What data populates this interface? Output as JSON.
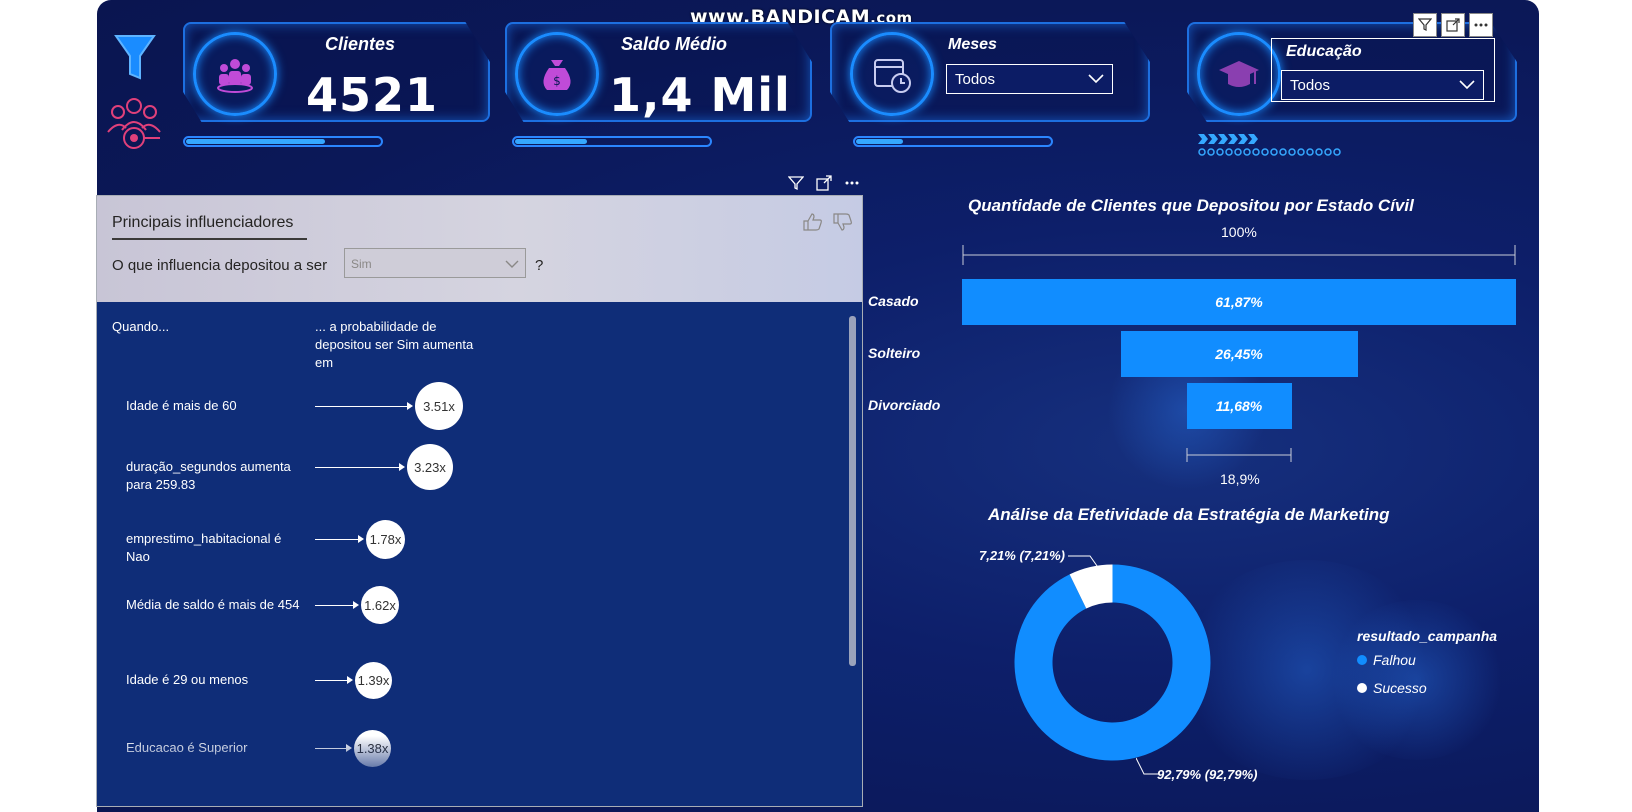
{
  "watermark": {
    "main": "www.BANDICAM",
    "suffix": ".com"
  },
  "kpis": {
    "clientes": {
      "title": "Clientes",
      "value": "4521",
      "progress": 0.72
    },
    "saldo": {
      "title": "Saldo Médio",
      "value": "1,4 Mil",
      "progress": 0.38
    },
    "meses": {
      "title": "Meses",
      "selected": "Todos",
      "progress": 0.25
    },
    "educacao": {
      "title": "Educação",
      "selected": "Todos"
    }
  },
  "influencers": {
    "title": "Principais influenciadores",
    "question": "O que influencia depositou a ser",
    "selected": "Sim",
    "question_mark": "?",
    "col_when": "Quando...",
    "col_prob": "... a probabilidade de depositou ser Sim aumenta em",
    "rows": [
      {
        "label": "Idade é mais de 60",
        "value": "3.51x",
        "factor": 3.51
      },
      {
        "label": "duração_segundos aumenta para 259.83",
        "value": "3.23x",
        "factor": 3.23
      },
      {
        "label": "emprestimo_habitacional é Nao",
        "value": "1.78x",
        "factor": 1.78
      },
      {
        "label": "Média de saldo é mais de 454",
        "value": "1.62x",
        "factor": 1.62
      },
      {
        "label": "Idade é 29 ou menos",
        "value": "1.39x",
        "factor": 1.39
      },
      {
        "label": "Educacao é Superior",
        "value": "1.38x",
        "factor": 1.38
      }
    ]
  },
  "funnel": {
    "title": "Quantidade de Clientes que Depositou por Estado Cívil",
    "top_label": "100%",
    "bottom_label": "18,9%",
    "categories": [
      "Casado",
      "Solteiro",
      "Divorciado"
    ],
    "labels": [
      "61,87%",
      "26,45%",
      "11,68%"
    ]
  },
  "donut": {
    "title": "Análise da Efetividade da Estratégia de Marketing",
    "legend_title": "resultado_campanha",
    "slices": [
      {
        "name": "Falhou",
        "label": "92,79% (92,79%)",
        "color": "#118dff"
      },
      {
        "name": "Sucesso",
        "label": "7,21% (7,21%)",
        "color": "#ffffff"
      }
    ]
  },
  "chart_data": [
    {
      "type": "bar",
      "title": "Quantidade de Clientes que Depositou por Estado Cívil",
      "categories": [
        "Casado",
        "Solteiro",
        "Divorciado"
      ],
      "values": [
        61.87,
        26.45,
        11.68
      ],
      "top_label": "100%",
      "bottom_label": "18,9%"
    },
    {
      "type": "pie",
      "title": "Análise da Efetividade da Estratégia de Marketing",
      "categories": [
        "Falhou",
        "Sucesso"
      ],
      "values": [
        92.79,
        7.21
      ],
      "legend_title": "resultado_campanha"
    }
  ]
}
